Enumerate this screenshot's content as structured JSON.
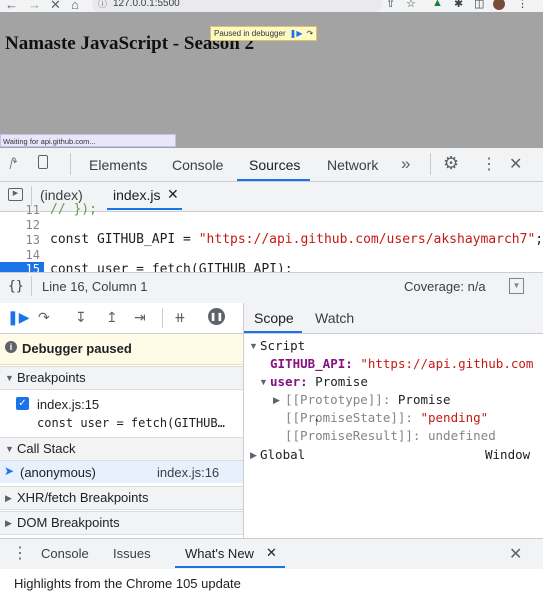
{
  "browser": {
    "url": "127.0.0.1:5500",
    "nav_icons": [
      "back-icon",
      "forward-icon",
      "stop-icon",
      "home-icon"
    ],
    "ext_icons": [
      "share-icon",
      "star-icon",
      "extension-icon",
      "puzzle-icon",
      "sidebar-icon",
      "profile-avatar",
      "kebab-menu-icon"
    ]
  },
  "page": {
    "heading": "Namaste JavaScript - Season 2",
    "paused_badge": "Paused in debugger",
    "status": "Waiting for api.github.com..."
  },
  "devtools": {
    "tabs": [
      "Elements",
      "Console",
      "Sources",
      "Network"
    ],
    "more": "»",
    "open_files": [
      "(index)",
      "index.js"
    ],
    "code": [
      {
        "ln": "11",
        "text": "// });"
      },
      {
        "ln": "12",
        "text": ""
      },
      {
        "ln": "13",
        "pre": "const GITHUB_API = ",
        "str": "\"https://api.github.com/users/akshaymarch7\"",
        "post": ";"
      },
      {
        "ln": "14",
        "text": ""
      },
      {
        "ln": "15",
        "text": "const user = fetch(GITHUB_API);"
      }
    ],
    "status": {
      "braces": "{}",
      "position": "Line 16, Column 1",
      "coverage": "Coverage: n/a"
    },
    "debugger": {
      "paused": "Debugger paused",
      "breakpoints_label": "Breakpoints",
      "breakpoint_file": "index.js:15",
      "breakpoint_code": "const user = fetch(GITHUB…",
      "callstack_label": "Call Stack",
      "callstack_fn": "(anonymous)",
      "callstack_loc": "index.js:16",
      "xhr_label": "XHR/fetch Breakpoints",
      "dom_label": "DOM Breakpoints"
    },
    "scope": {
      "tabs": [
        "Scope",
        "Watch"
      ],
      "script_label": "Script",
      "github_key": "GITHUB_API:",
      "github_val": "\"https://api.github.com",
      "user_key": "user:",
      "user_val": "Promise",
      "proto_key": "[[Prototype]]:",
      "proto_val": "Promise",
      "state_key": "[[PromiseState]]:",
      "state_val": "\"pending\"",
      "result_key": "[[PromiseResult]]:",
      "result_val": "undefined",
      "global_label": "Global",
      "global_val": "Window"
    },
    "drawer": {
      "tabs": [
        "Console",
        "Issues",
        "What's New"
      ],
      "content": "Highlights from the Chrome 105 update"
    }
  },
  "colors": {
    "accent": "#1a73e8",
    "string": "#c41a16",
    "property": "#881280",
    "paused_bg": "#fffbe6"
  }
}
